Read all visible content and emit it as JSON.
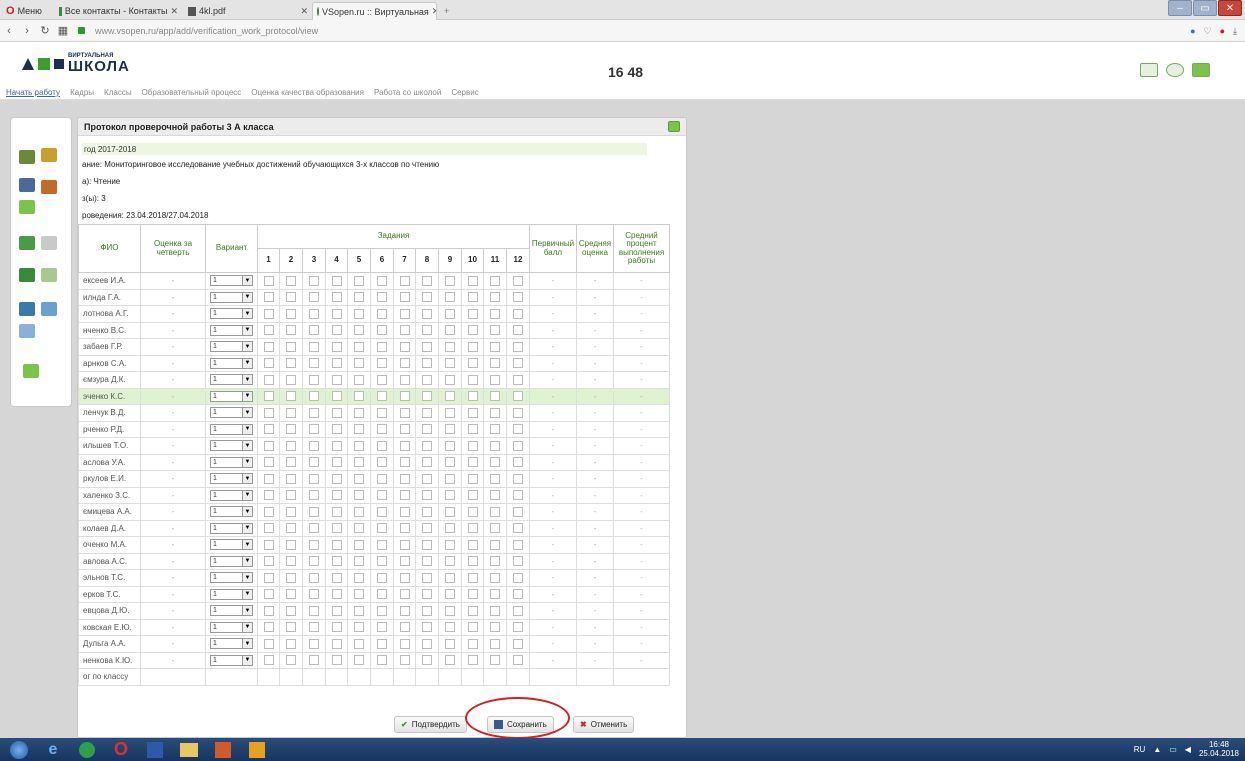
{
  "browser": {
    "tabs": [
      {
        "label": "Меню",
        "active": false
      },
      {
        "label": "Все контакты - Контакты",
        "active": false
      },
      {
        "label": "4kl.pdf",
        "active": false
      },
      {
        "label": "VSopen.ru :: Виртуальная",
        "active": true
      }
    ],
    "url": "www.vsopen.ru/app/add/verification_work_protocol/view",
    "close_glyph": "✕"
  },
  "app": {
    "logo_small": "ВИРТУАЛЬНАЯ",
    "logo_big": "ШКОЛА",
    "clock": "16 48",
    "menu": [
      "Начать работу",
      "Кадры",
      "Классы",
      "Образовательный процесс",
      "Оценка качества образования",
      "Работа со школой",
      "Сервис"
    ]
  },
  "panel": {
    "title": "Протокол проверочной работы 3 А класса",
    "year": "год 2017-2018",
    "task": "ание: Мониторинговое исследование учебных достижений обучающихся 3-х классов по чтению",
    "subject": "а): Чтение",
    "grade": "з(ы): 3",
    "dates": "роведения: 23.04.2018/27.04.2018"
  },
  "table": {
    "headers": {
      "fio": "ФИО",
      "quarter": "Оценка за четверть",
      "variant": "Вариант",
      "tasks": "Задания",
      "primary": "Первичный балл",
      "avg_grade": "Средняя оценка",
      "avg_pct": "Средний процент выполнения работы"
    },
    "task_numbers": [
      "1",
      "2",
      "3",
      "4",
      "5",
      "6",
      "7",
      "8",
      "9",
      "10",
      "11",
      "12"
    ],
    "rows": [
      {
        "fio": "ексеев И.А.",
        "quarter": "-",
        "variant": "1",
        "primary": "-",
        "avg_grade": "-",
        "avg_pct": "-"
      },
      {
        "fio": "илнда Г.А.",
        "quarter": "-",
        "variant": "1",
        "primary": "-",
        "avg_grade": "-",
        "avg_pct": "-"
      },
      {
        "fio": "лотнова А.Г.",
        "quarter": "-",
        "variant": "1",
        "primary": "-",
        "avg_grade": "-",
        "avg_pct": "-"
      },
      {
        "fio": "нченко В.С.",
        "quarter": "-",
        "variant": "1",
        "primary": "-",
        "avg_grade": "-",
        "avg_pct": "-"
      },
      {
        "fio": "забаев Г.Р.",
        "quarter": "-",
        "variant": "1",
        "primary": "-",
        "avg_grade": "-",
        "avg_pct": "-"
      },
      {
        "fio": "арнков С.А.",
        "quarter": "-",
        "variant": "1",
        "primary": "-",
        "avg_grade": "-",
        "avg_pct": "-"
      },
      {
        "fio": "ємзура Д.К.",
        "quarter": "-",
        "variant": "1",
        "primary": "-",
        "avg_grade": "-",
        "avg_pct": "-"
      },
      {
        "fio": "эченко К.С.",
        "quarter": "-",
        "variant": "1",
        "primary": "-",
        "avg_grade": "-",
        "avg_pct": "-",
        "highlight": true
      },
      {
        "fio": "ленчук В.Д.",
        "quarter": "-",
        "variant": "1",
        "primary": "-",
        "avg_grade": "-",
        "avg_pct": "-"
      },
      {
        "fio": "рченко Р.Д.",
        "quarter": "-",
        "variant": "1",
        "primary": "-",
        "avg_grade": "-",
        "avg_pct": "-"
      },
      {
        "fio": "ильшев Т.О.",
        "quarter": "-",
        "variant": "1",
        "primary": "-",
        "avg_grade": "-",
        "avg_pct": "-"
      },
      {
        "fio": "аслова У.А.",
        "quarter": "-",
        "variant": "1",
        "primary": "-",
        "avg_grade": "-",
        "avg_pct": "-"
      },
      {
        "fio": "ркулов Е.И.",
        "quarter": "-",
        "variant": "1",
        "primary": "-",
        "avg_grade": "-",
        "avg_pct": "-"
      },
      {
        "fio": "халенко З.С.",
        "quarter": "-",
        "variant": "1",
        "primary": "-",
        "avg_grade": "-",
        "avg_pct": "-"
      },
      {
        "fio": "ємицева А.А.",
        "quarter": "-",
        "variant": "1",
        "primary": "-",
        "avg_grade": "-",
        "avg_pct": "-"
      },
      {
        "fio": "колаев Д.А.",
        "quarter": "-",
        "variant": "1",
        "primary": "-",
        "avg_grade": "-",
        "avg_pct": "-"
      },
      {
        "fio": "оченко М.А.",
        "quarter": "-",
        "variant": "1",
        "primary": "-",
        "avg_grade": "-",
        "avg_pct": "-"
      },
      {
        "fio": "авлова А.С.",
        "quarter": "-",
        "variant": "1",
        "primary": "-",
        "avg_grade": "-",
        "avg_pct": "-"
      },
      {
        "fio": "эльнов Т.С.",
        "quarter": "-",
        "variant": "1",
        "primary": "-",
        "avg_grade": "-",
        "avg_pct": "-"
      },
      {
        "fio": "ерков Т.С.",
        "quarter": "-",
        "variant": "1",
        "primary": "-",
        "avg_grade": "-",
        "avg_pct": "-"
      },
      {
        "fio": "евцова Д.Ю.",
        "quarter": "-",
        "variant": "1",
        "primary": "-",
        "avg_grade": "-",
        "avg_pct": "-"
      },
      {
        "fio": "ковская Е.Ю.",
        "quarter": "-",
        "variant": "1",
        "primary": "-",
        "avg_grade": "-",
        "avg_pct": "-"
      },
      {
        "fio": "Дульга А.А.",
        "quarter": "-",
        "variant": "1",
        "primary": "-",
        "avg_grade": "-",
        "avg_pct": "-"
      },
      {
        "fio": "ненкова К.Ю.",
        "quarter": "-",
        "variant": "1",
        "primary": "-",
        "avg_grade": "-",
        "avg_pct": "-"
      }
    ],
    "total_label": "ог по классу"
  },
  "buttons": {
    "confirm": "Подтвердить",
    "save": "Сохранить",
    "cancel": "Отменить"
  },
  "taskbar": {
    "lang": "RU",
    "time": "16:48",
    "date": "25.04.2018"
  }
}
